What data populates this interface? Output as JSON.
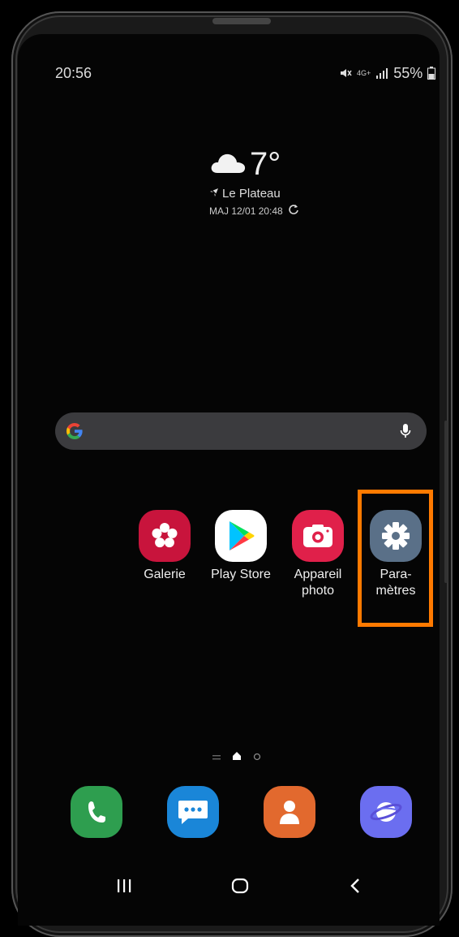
{
  "status_bar": {
    "time": "20:56",
    "battery": "55%",
    "network": "4G+"
  },
  "weather": {
    "temperature": "7°",
    "location": "Le Plateau",
    "updated": "MAJ 12/01 20:48"
  },
  "search": {
    "placeholder": ""
  },
  "apps": [
    {
      "label": "Galerie",
      "icon": "flower-icon",
      "color": "#c8143c"
    },
    {
      "label": "Play Store",
      "icon": "play-store-icon",
      "color": "#ffffff"
    },
    {
      "label_line1": "Appareil",
      "label_line2": "photo",
      "icon": "camera-icon",
      "color": "#e0204a"
    },
    {
      "label_line1": "Para-",
      "label_line2": "mètres",
      "icon": "gear-icon",
      "color": "#5a7088"
    }
  ],
  "highlight_color": "#ff7a00",
  "dock": [
    {
      "name": "phone-icon",
      "color": "#2e9e4f"
    },
    {
      "name": "messages-icon",
      "color": "#1a86d8"
    },
    {
      "name": "contacts-icon",
      "color": "#e2692e"
    },
    {
      "name": "internet-icon",
      "color": "#6b6ef0"
    }
  ]
}
